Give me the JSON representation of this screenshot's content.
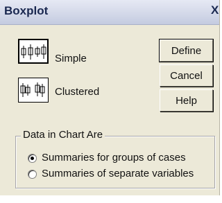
{
  "window": {
    "title": "Boxplot",
    "close_glyph": "X"
  },
  "chart_types": [
    {
      "label": "Simple",
      "selected": true,
      "icon": "simple-boxplot-icon"
    },
    {
      "label": "Clustered",
      "selected": false,
      "icon": "clustered-boxplot-icon"
    }
  ],
  "buttons": {
    "define": "Define",
    "cancel": "Cancel",
    "help": "Help"
  },
  "data_group": {
    "legend": "Data in Chart Are",
    "options": [
      {
        "label": "Summaries for groups of cases",
        "checked": true
      },
      {
        "label": "Summaries of separate variables",
        "checked": false
      }
    ]
  }
}
